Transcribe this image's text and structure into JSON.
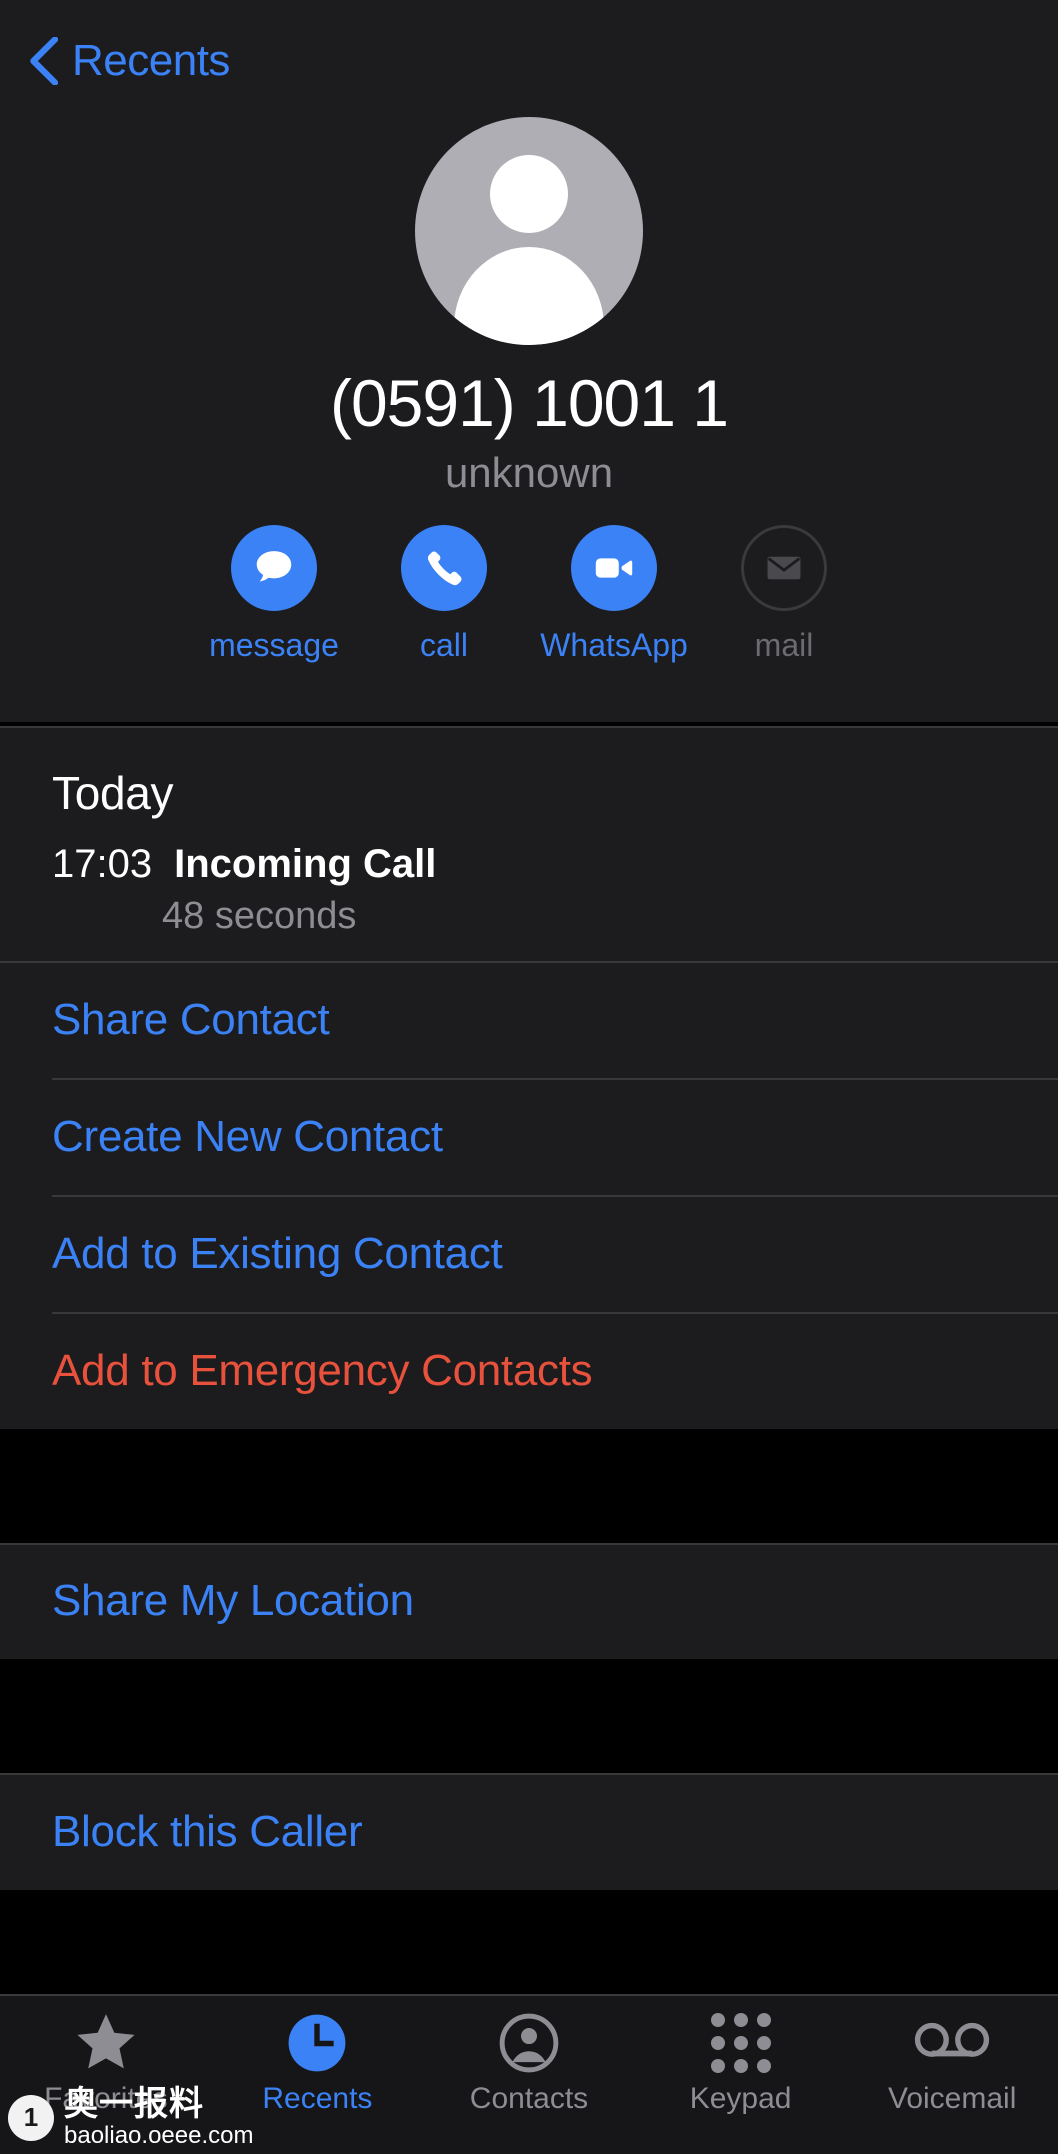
{
  "header": {
    "back_label": "Recents",
    "back_icon": "chevron-left-icon"
  },
  "contact": {
    "phone_number": "(0591) 1001 1",
    "sub_label": "unknown",
    "avatar_icon": "person-placeholder-icon"
  },
  "actions": [
    {
      "label": "message",
      "icon": "message-bubble-icon",
      "enabled": true
    },
    {
      "label": "call",
      "icon": "phone-icon",
      "enabled": true
    },
    {
      "label": "WhatsApp",
      "icon": "video-camera-icon",
      "enabled": true
    },
    {
      "label": "mail",
      "icon": "envelope-icon",
      "enabled": false
    }
  ],
  "history": {
    "day": "Today",
    "time": "17:03",
    "type": "Incoming Call",
    "duration": "48 seconds"
  },
  "contact_actions": [
    {
      "label": "Share Contact",
      "style": "link"
    },
    {
      "label": "Create New Contact",
      "style": "link"
    },
    {
      "label": "Add to Existing Contact",
      "style": "link"
    },
    {
      "label": "Add to Emergency Contacts",
      "style": "danger"
    }
  ],
  "location_actions": [
    {
      "label": "Share My Location",
      "style": "link"
    }
  ],
  "block_actions": [
    {
      "label": "Block this Caller",
      "style": "link"
    }
  ],
  "tabs": [
    {
      "label": "Favorites",
      "icon": "star-icon",
      "active": false
    },
    {
      "label": "Recents",
      "icon": "clock-icon",
      "active": true
    },
    {
      "label": "Contacts",
      "icon": "person-circle-icon",
      "active": false
    },
    {
      "label": "Keypad",
      "icon": "keypad-grid-icon",
      "active": false
    },
    {
      "label": "Voicemail",
      "icon": "voicemail-icon",
      "active": false
    }
  ],
  "watermark": {
    "badge": "1",
    "title": "奥一报料",
    "url": "baoliao.oeee.com"
  },
  "colors": {
    "accent": "#3b82f6",
    "danger": "#e8513c",
    "card": "#1c1c1e",
    "background": "#000000",
    "secondary_text": "#8d8d93"
  }
}
